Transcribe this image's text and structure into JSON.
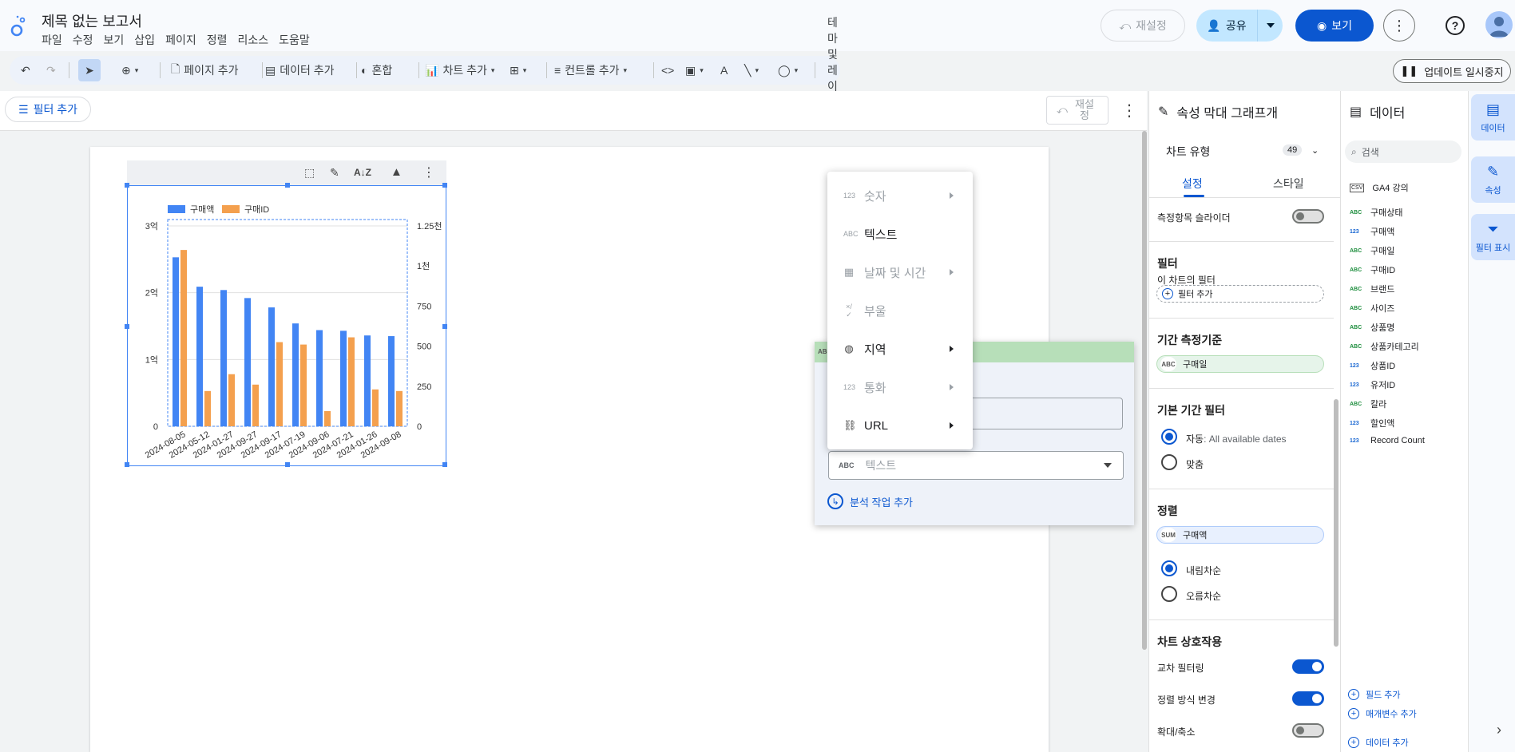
{
  "app": {
    "title": "제목 없는 보고서",
    "menu": [
      "파일",
      "수정",
      "보기",
      "삽입",
      "페이지",
      "정렬",
      "리소스",
      "도움말"
    ]
  },
  "header": {
    "reset": "재설정",
    "share": "공유",
    "view": "보기"
  },
  "toolbar": {
    "add_page": "페이지 추가",
    "add_data": "데이터 추가",
    "blend": "혼합",
    "add_chart": "차트 추가",
    "add_control": "컨트롤 추가",
    "theme": "테마 및 레이아웃",
    "pause": "업데이트 일시중지"
  },
  "filterbar": {
    "add_filter": "필터 추가",
    "reset": "재설정"
  },
  "chart_data": {
    "type": "bar",
    "categories": [
      "2024-08-05",
      "2024-05-12",
      "2024-01-27",
      "2024-09-27",
      "2024-09-17",
      "2024-07-19",
      "2024-09-06",
      "2024-07-21",
      "2024-01-26",
      "2024-09-08"
    ],
    "x_tick_labels": [
      "2024-08-05",
      "2024-05-12",
      "2024-01-27",
      "2024-09-27",
      "2024-09-17",
      "2024-07-19",
      "2024-09-06",
      "2024-07-21",
      "2024-01-26",
      "2024-09-08"
    ],
    "series": [
      {
        "name": "구매액",
        "axis": "left",
        "color": "#4285f4",
        "values": [
          253000000,
          209000000,
          204000000,
          192000000,
          178000000,
          154000000,
          144000000,
          143000000,
          136000000,
          135000000
        ]
      },
      {
        "name": "구매ID",
        "axis": "right",
        "color": "#f4a04e",
        "values": [
          1100,
          220,
          325,
          260,
          525,
          510,
          95,
          555,
          230,
          220
        ]
      }
    ],
    "left_axis": {
      "min": 0,
      "max": 300000000,
      "ticks": [
        0,
        100000000,
        200000000,
        300000000
      ],
      "labels": [
        "0",
        "1억",
        "2억",
        "3억"
      ]
    },
    "right_axis": {
      "min": 0,
      "max": 1250,
      "ticks": [
        0,
        250,
        500,
        750,
        1000,
        1250
      ],
      "labels": [
        "0",
        "250",
        "500",
        "750",
        "1천",
        "1.25천"
      ]
    },
    "legend_position": "top-left",
    "grid": true
  },
  "type_menu": {
    "items": [
      {
        "icon": "123",
        "label": "숫자",
        "enabled": false,
        "submenu": true
      },
      {
        "icon": "ABC",
        "label": "텍스트",
        "enabled": true,
        "submenu": false
      },
      {
        "icon": "calendar-icon",
        "label": "날짜 및 시간",
        "enabled": false,
        "submenu": true
      },
      {
        "icon": "×/✓",
        "label": "부울",
        "enabled": false,
        "submenu": false
      },
      {
        "icon": "globe-icon",
        "label": "지역",
        "enabled": true,
        "submenu": true
      },
      {
        "icon": "123",
        "label": "통화",
        "enabled": false,
        "submenu": true
      },
      {
        "icon": "link-icon",
        "label": "URL",
        "enabled": true,
        "submenu": true
      }
    ]
  },
  "popup": {
    "head_tag": "ABC",
    "select_tag": "ABC",
    "select_value": "텍스트",
    "add_calc": "분석 작업 추가"
  },
  "props": {
    "title": "속성 막대 그래프개",
    "chart_type": "차트 유형",
    "chart_type_count": "49",
    "tab_setup": "설정",
    "tab_style": "스타일",
    "metric_slider": "측정항목 슬라이더",
    "filter_h": "필터",
    "filter_sub": "이 차트의 필터",
    "filter_add": "필터 추가",
    "date_dim_h": "기간 측정기준",
    "date_dim_tag": "ABC",
    "date_dim_value": "구매일",
    "default_date_h": "기본 기간 필터",
    "auto": "자동",
    "auto_value": ": All available dates",
    "custom": "맞춤",
    "sort_h": "정렬",
    "sort_tag": "SUM",
    "sort_value": "구매액",
    "desc": "내림차순",
    "asc": "오름차순",
    "interact_h": "차트 상호작용",
    "cross_filter": "교차 필터링",
    "change_sort": "정렬 방식 변경",
    "zoom": "확대/축소"
  },
  "data_panel": {
    "title": "데이터",
    "search_placeholder": "검색",
    "source_tag": "CSV",
    "source": "GA4 강의",
    "fields": [
      {
        "type": "ABC",
        "name": "구매상태"
      },
      {
        "type": "123",
        "name": "구매액"
      },
      {
        "type": "ABC",
        "name": "구매일"
      },
      {
        "type": "ABC",
        "name": "구매ID"
      },
      {
        "type": "ABC",
        "name": "브랜드"
      },
      {
        "type": "ABC",
        "name": "사이즈"
      },
      {
        "type": "ABC",
        "name": "상품명"
      },
      {
        "type": "ABC",
        "name": "상품카테고리"
      },
      {
        "type": "123",
        "name": "상품ID"
      },
      {
        "type": "123",
        "name": "유저ID"
      },
      {
        "type": "ABC",
        "name": "칼라"
      },
      {
        "type": "123",
        "name": "할인액"
      },
      {
        "type": "123",
        "name": "Record Count"
      }
    ],
    "add_field": "필드 추가",
    "add_param": "매개변수 추가",
    "add_data": "데이터 추가"
  },
  "rail": {
    "data": "데이터",
    "props": "속성",
    "filter": "필터 표시"
  }
}
